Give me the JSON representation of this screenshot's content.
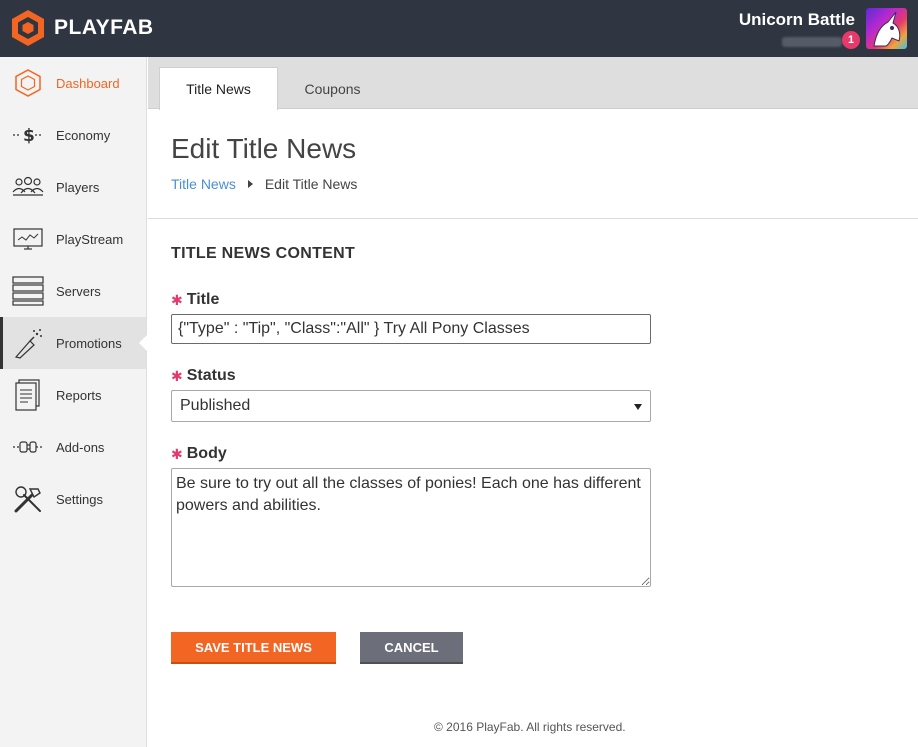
{
  "header": {
    "brand": "PLAYFAB",
    "game_title": "Unicorn Battle",
    "notification_count": "1",
    "background_color": "#2f3541"
  },
  "sidebar": {
    "items": [
      {
        "label": "Dashboard",
        "icon": "hexagon-icon",
        "active": true
      },
      {
        "label": "Economy",
        "icon": "dollar-icon"
      },
      {
        "label": "Players",
        "icon": "players-icon"
      },
      {
        "label": "PlayStream",
        "icon": "monitor-icon"
      },
      {
        "label": "Servers",
        "icon": "servers-icon"
      },
      {
        "label": "Promotions",
        "icon": "champagne-icon",
        "selected": true
      },
      {
        "label": "Reports",
        "icon": "reports-icon"
      },
      {
        "label": "Add-ons",
        "icon": "plug-icon"
      },
      {
        "label": "Settings",
        "icon": "tools-icon"
      }
    ]
  },
  "tabs": [
    {
      "label": "Title News",
      "active": true
    },
    {
      "label": "Coupons",
      "active": false
    }
  ],
  "main": {
    "page_title": "Edit Title News",
    "breadcrumb": {
      "link": "Title News",
      "current": "Edit Title News"
    },
    "section_title": "TITLE NEWS CONTENT",
    "fields": {
      "title": {
        "label": "Title",
        "value": "{\"Type\" : \"Tip\", \"Class\":\"All\" } Try All Pony Classes"
      },
      "status": {
        "label": "Status",
        "value": "Published"
      },
      "body": {
        "label": "Body",
        "value": "Be sure to try out all the classes of ponies! Each one has different powers and abilities."
      }
    },
    "buttons": {
      "save": "SAVE TITLE NEWS",
      "cancel": "CANCEL"
    },
    "required_marker": "✱"
  },
  "footer": "© 2016 PlayFab. All rights reserved.",
  "colors": {
    "accent": "#f26522",
    "link": "#4a8fd6",
    "required": "#e63a6a",
    "cancel": "#6c6f7a"
  }
}
